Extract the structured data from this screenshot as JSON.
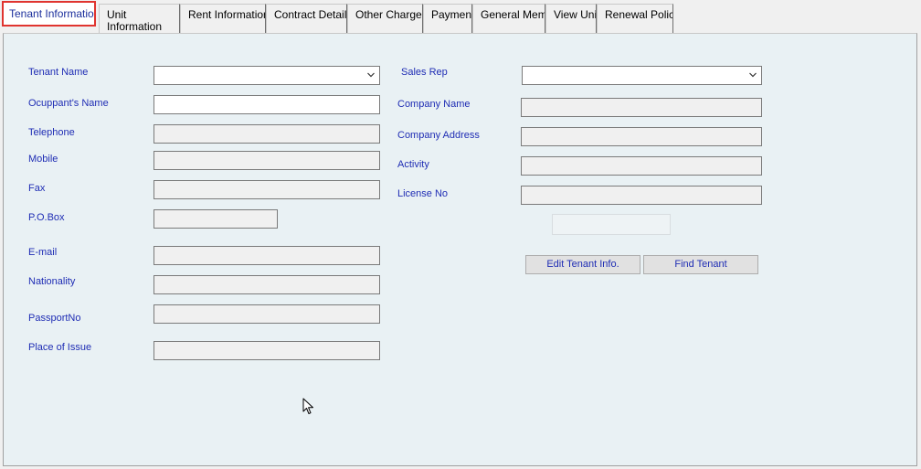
{
  "tabs": [
    {
      "label": "Tenant Information",
      "active": true
    },
    {
      "label": "Unit Information"
    },
    {
      "label": "Rent Information"
    },
    {
      "label": "Contract Details"
    },
    {
      "label": "Other Charges"
    },
    {
      "label": "Payments"
    },
    {
      "label": "General Memo"
    },
    {
      "label": "View Unit"
    },
    {
      "label": "Renewal Policy"
    }
  ],
  "form": {
    "tenant_name_label": "Tenant Name",
    "tenant_name_value": "",
    "occupant_label": "Ocuppant's Name",
    "occupant_value": "",
    "telephone_label": "Telephone",
    "mobile_label": "Mobile",
    "fax_label": "Fax",
    "pobox_label": "P.O.Box",
    "email_label": "E-mail",
    "nationality_label": "Nationality",
    "passport_label": "PassportNo",
    "place_of_issue_label": "Place of Issue",
    "sales_rep_label": "Sales Rep",
    "sales_rep_value": "",
    "company_name_label": "Company Name",
    "company_address_label": "Company Address",
    "activity_label": "Activity",
    "license_label": "License No"
  },
  "buttons": {
    "edit_tenant": "Edit Tenant Info.",
    "find_tenant": "Find Tenant"
  },
  "icons": {
    "dropdown": "chevron-down-icon",
    "cursor": "mouse-pointer-icon"
  },
  "colors": {
    "label_blue": "#1f2db4",
    "panel_bg": "#e9f1f4",
    "active_tab_border": "#e0342f"
  }
}
